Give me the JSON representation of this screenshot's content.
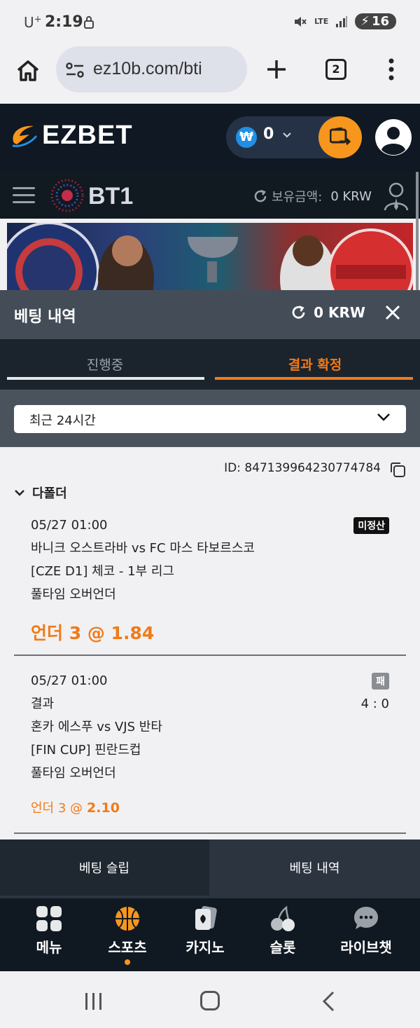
{
  "status_bar": {
    "carrier": "U",
    "carrier_sup": "+",
    "time": "2:19",
    "network": "LTE",
    "battery": "16"
  },
  "browser": {
    "url": "ez10b.com/bti",
    "tab_count": "2"
  },
  "site": {
    "logo_text": "EZBET",
    "wallet_currency_symbol": "₩",
    "wallet_value": "0"
  },
  "bti": {
    "logo_text": "BT1",
    "balance_label": "보유금액:",
    "balance_value": "0 KRW"
  },
  "bet_history": {
    "title": "베팅 내역",
    "balance": "0 KRW",
    "tabs": [
      "진행중",
      "결과 확정"
    ],
    "active_tab_index": 1,
    "filter_selected": "최근 24시간",
    "bet": {
      "id_label": "ID:",
      "id_value": "847139964230774784",
      "type": "다폴더",
      "selections": [
        {
          "datetime": "05/27 01:00",
          "status": "미정산",
          "match": "바니크 오스트라바 vs FC 마스 타보르스코",
          "league": "[CZE D1] 체코 - 1부 리그",
          "market": "풀타임 오버언더",
          "pick_name": "언더 3",
          "pick_at": "@",
          "odds": "1.84"
        },
        {
          "datetime": "05/27 01:00",
          "status": "패",
          "result_label": "결과",
          "score": "4 : 0",
          "match": "혼카 에스푸 vs VJS 반타",
          "league": "[FIN CUP] 핀란드컵",
          "market": "풀타임 오버언더",
          "pick_name": "언더 3",
          "pick_at": "@",
          "odds": "2.10"
        }
      ]
    }
  },
  "slip_bar": {
    "tabs": [
      "베팅 슬립",
      "베팅 내역"
    ]
  },
  "bottom_nav": {
    "items": [
      {
        "label": "메뉴",
        "icon": "grid-icon"
      },
      {
        "label": "스포츠",
        "icon": "basketball-icon"
      },
      {
        "label": "카지노",
        "icon": "cards-icon"
      },
      {
        "label": "슬롯",
        "icon": "cherry-icon"
      },
      {
        "label": "라이브챗",
        "icon": "chat-icon"
      }
    ],
    "active_index": 1
  },
  "colors": {
    "accent": "#f07b18",
    "header_bg": "#0f1823",
    "panel_bg": "#444d57"
  }
}
